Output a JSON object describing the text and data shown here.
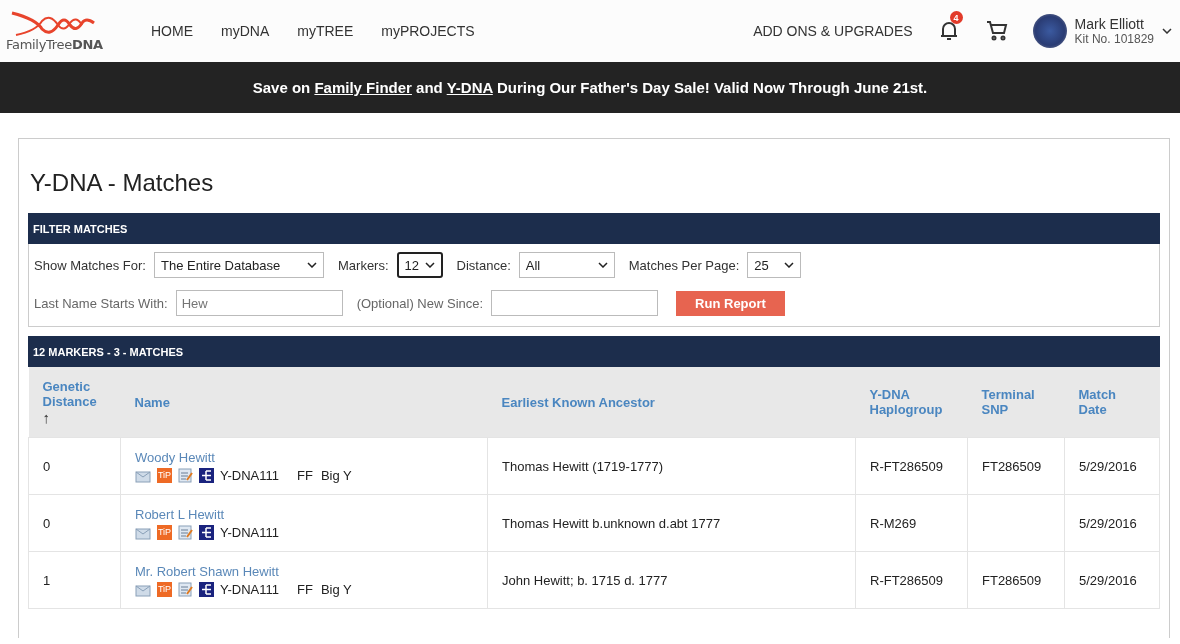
{
  "header": {
    "logo": "FamilyTree**DNA**",
    "nav": [
      {
        "label": "HOME"
      },
      {
        "label": "myDNA"
      },
      {
        "label": "myTREE"
      },
      {
        "label": "myPROJECTS"
      }
    ],
    "addons": "ADD ONS & UPGRADES",
    "notifications": "4",
    "user": {
      "name": "Mark Elliott",
      "kit": "Kit No. 101829"
    }
  },
  "banner": [
    {
      "kind": "text",
      "text": "Save on "
    },
    {
      "kind": "link",
      "text": "Family Finder"
    },
    {
      "kind": "text",
      "text": " and "
    },
    {
      "kind": "link",
      "text": "Y-DNA"
    },
    {
      "kind": "text",
      "text": " During Our Father's Day Sale! Valid Now Through June 21st."
    }
  ],
  "page_title": "Y-DNA - Matches",
  "filter": {
    "title": "FILTER MATCHES",
    "selects": [
      {
        "label": "Show Matches For:",
        "value": "The Entire Database",
        "focused": false
      },
      {
        "label": "Markers:",
        "value": "12",
        "focused": true
      },
      {
        "label": "Distance:",
        "value": "All",
        "focused": false
      },
      {
        "label": "Matches Per Page:",
        "value": "25",
        "focused": false
      }
    ],
    "fields": [
      {
        "label": "Last Name Starts With:",
        "placeholder": "Hew"
      },
      {
        "label": "(Optional) New Since:"
      }
    ],
    "button": "Run Report"
  },
  "results": {
    "title": "12 MARKERS - 3 - MATCHES",
    "columns": [
      {
        "label": "Genetic Distance",
        "sort": "↑"
      },
      {
        "label": "Name"
      },
      {
        "label": "Earliest Known Ancestor"
      },
      {
        "label": "Y-DNA Haplogroup"
      },
      {
        "label": "Terminal SNP"
      },
      {
        "label": "Match Date"
      }
    ],
    "rows": [
      {
        "distance": "0",
        "name": "Woody Hewitt",
        "tip": "TiP",
        "tests": [
          "Y-DNA111",
          "FF",
          "Big Y"
        ],
        "ancestor": "Thomas Hewitt (1719-1777)",
        "haplogroup": "R-FT286509",
        "snp": "FT286509",
        "date": "5/29/2016"
      },
      {
        "distance": "0",
        "name": "Robert L Hewitt",
        "tip": "TiP",
        "tests": [
          "Y-DNA111"
        ],
        "ancestor": "Thomas Hewitt b.unknown d.abt 1777",
        "haplogroup": "R-M269",
        "date": "5/29/2016"
      },
      {
        "distance": "1",
        "name": "Mr. Robert Shawn Hewitt",
        "tip": "TiP",
        "tests": [
          "Y-DNA111",
          "FF",
          "Big Y"
        ],
        "ancestor": "John Hewitt; b. 1715 d. 1777",
        "haplogroup": "R-FT286509",
        "snp": "FT286509",
        "date": "5/29/2016"
      }
    ]
  }
}
